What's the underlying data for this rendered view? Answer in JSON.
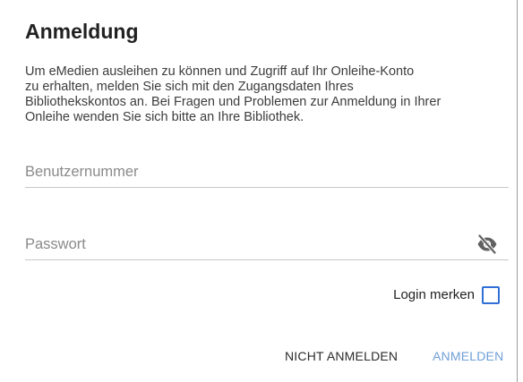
{
  "dialog": {
    "title": "Anmeldung",
    "message": "Um eMedien ausleihen zu können und Zugriff auf Ihr Onleihe-Konto\nzu erhalten, melden Sie sich mit den Zugangsdaten Ihres\nBibliothekskontos an. Bei Fragen und Problemen zur Anmeldung in Ihrer\nOnleihe wenden Sie sich bitte an Ihre Bibliothek.",
    "username": {
      "placeholder": "Benutzernummer",
      "value": ""
    },
    "password": {
      "placeholder": "Passwort",
      "value": "",
      "toggle_icon": "eye-off-icon"
    },
    "remember": {
      "label": "Login merken",
      "checked": false
    },
    "actions": {
      "cancel_label": "NICHT ANMELDEN",
      "login_label": "ANMELDEN"
    }
  },
  "colors": {
    "accent": "#2f6fd6",
    "login_button": "#6f9fd8",
    "divider": "#c8c8c8",
    "placeholder": "#8a8a8a"
  }
}
